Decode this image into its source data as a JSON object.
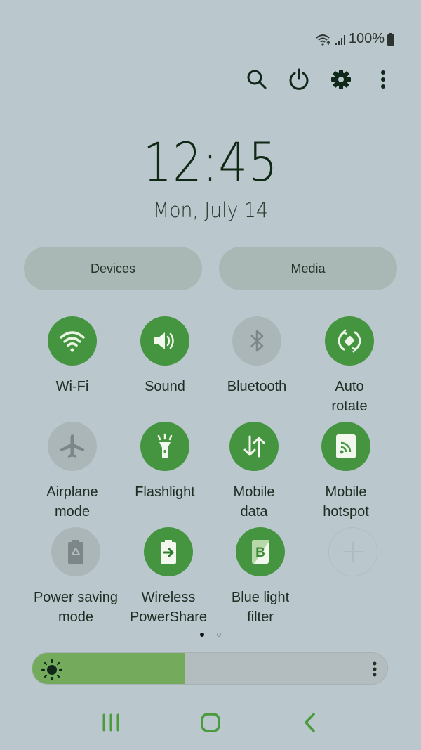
{
  "status_bar": {
    "wifi_icon": "wifi-data-icon",
    "signal_icon": "signal-bars-icon",
    "battery_text": "100%",
    "battery_icon": "battery-full-icon"
  },
  "top_actions": [
    {
      "name": "search",
      "icon": "search-icon"
    },
    {
      "name": "power",
      "icon": "power-icon"
    },
    {
      "name": "settings",
      "icon": "gear-icon"
    },
    {
      "name": "more",
      "icon": "more-vertical-icon"
    }
  ],
  "clock": {
    "time": "12:45",
    "date": "Mon, July 14"
  },
  "pills": {
    "devices": "Devices",
    "media": "Media"
  },
  "tiles": [
    {
      "label": "Wi-Fi",
      "state": "on",
      "icon": "wifi-icon"
    },
    {
      "label": "Sound",
      "state": "on",
      "icon": "speaker-icon"
    },
    {
      "label": "Bluetooth",
      "state": "off",
      "icon": "bluetooth-icon"
    },
    {
      "label": "Auto\nrotate",
      "state": "on",
      "icon": "auto-rotate-icon"
    },
    {
      "label": "Airplane\nmode",
      "state": "off",
      "icon": "airplane-icon"
    },
    {
      "label": "Flashlight",
      "state": "on",
      "icon": "flashlight-icon"
    },
    {
      "label": "Mobile\ndata",
      "state": "on",
      "icon": "mobile-data-icon"
    },
    {
      "label": "Mobile\nhotspot",
      "state": "on",
      "icon": "hotspot-icon"
    },
    {
      "label": "Power saving\nmode",
      "state": "off",
      "icon": "power-saving-icon"
    },
    {
      "label": "Wireless\nPowerShare",
      "state": "on",
      "icon": "powershare-icon"
    },
    {
      "label": "Blue light\nfilter",
      "state": "on",
      "icon": "blue-light-filter-icon"
    },
    {
      "label": "",
      "state": "add",
      "icon": "add-icon"
    }
  ],
  "page_indicator": {
    "current": 1,
    "total": 2
  },
  "brightness": {
    "level_percent": 43,
    "icon": "sun-icon",
    "more_icon": "more-vertical-icon"
  },
  "navbar": [
    {
      "name": "recents",
      "icon": "recents-icon"
    },
    {
      "name": "home",
      "icon": "home-icon"
    },
    {
      "name": "back",
      "icon": "back-icon"
    }
  ],
  "colors": {
    "background": "#bac8cd",
    "tile_on": "#459540",
    "tile_off": "#abb6b8",
    "brightness_fill": "#73aa5b",
    "nav_accent": "#4a9a3e"
  }
}
